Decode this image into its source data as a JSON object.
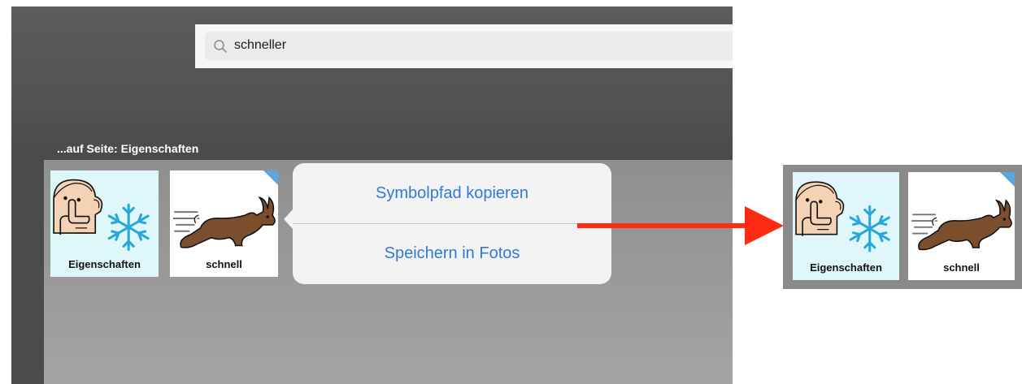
{
  "search": {
    "value": "schneller"
  },
  "section": {
    "label": "...auf Seite: Eigenschaften"
  },
  "tiles": [
    {
      "label": "Eigenschaften",
      "icon": "quiet-cold-symbol-icon"
    },
    {
      "label": "schnell",
      "icon": "running-rabbit-icon"
    }
  ],
  "popover": {
    "items": [
      {
        "label": "Symbolpfad kopieren"
      },
      {
        "label": "Speichern in Fotos"
      }
    ]
  },
  "copy": {
    "tiles": [
      {
        "label": "Eigenschaften"
      },
      {
        "label": "schnell"
      }
    ]
  },
  "colors": {
    "accent": "#2f7ad9",
    "arrow": "#ff2a12",
    "tile_corner": "#5da6dd",
    "tile_cyan": "#dff6fb"
  }
}
